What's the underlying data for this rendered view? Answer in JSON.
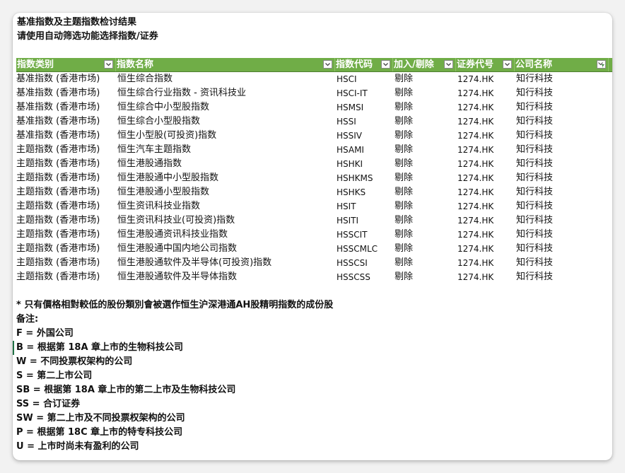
{
  "headings": {
    "title": "基准指数及主题指数检讨结果",
    "subtitle": "请使用自动筛选功能选择指数/证券"
  },
  "table": {
    "header_color": "#70ad47",
    "columns": [
      {
        "label": "指数类别",
        "filter": "dropdown"
      },
      {
        "label": "指数名称",
        "filter": "dropdown"
      },
      {
        "label": "指数代码",
        "filter": "dropdown"
      },
      {
        "label": "加入/剔除",
        "filter": "dropdown"
      },
      {
        "label": "证券代号",
        "filter": "dropdown"
      },
      {
        "label": "公司名称",
        "filter": "filter-active"
      }
    ],
    "rows": [
      [
        "基准指数 (香港市场)",
        "恒生综合指数",
        "HSCI",
        "剔除",
        "1274.HK",
        "知行科技"
      ],
      [
        "基准指数 (香港市场)",
        "恒生综合行业指数 - 资讯科技业",
        "HSCI-IT",
        "剔除",
        "1274.HK",
        "知行科技"
      ],
      [
        "基准指数 (香港市场)",
        "恒生综合中小型股指数",
        "HSMSI",
        "剔除",
        "1274.HK",
        "知行科技"
      ],
      [
        "基准指数 (香港市场)",
        "恒生综合小型股指数",
        "HSSI",
        "剔除",
        "1274.HK",
        "知行科技"
      ],
      [
        "基准指数 (香港市场)",
        "恒生小型股(可投资)指数",
        "HSSIV",
        "剔除",
        "1274.HK",
        "知行科技"
      ],
      [
        "主题指数 (香港市场)",
        "恒生汽车主题指数",
        "HSAMI",
        "剔除",
        "1274.HK",
        "知行科技"
      ],
      [
        "主题指数 (香港市场)",
        "恒生港股通指数",
        "HSHKI",
        "剔除",
        "1274.HK",
        "知行科技"
      ],
      [
        "主题指数 (香港市场)",
        "恒生港股通中小型股指数",
        "HSHKMS",
        "剔除",
        "1274.HK",
        "知行科技"
      ],
      [
        "主题指数 (香港市场)",
        "恒生港股通小型股指数",
        "HSHKS",
        "剔除",
        "1274.HK",
        "知行科技"
      ],
      [
        "主题指数 (香港市场)",
        "恒生资讯科技业指数",
        "HSIT",
        "剔除",
        "1274.HK",
        "知行科技"
      ],
      [
        "主题指数 (香港市场)",
        "恒生资讯科技业(可投资)指数",
        "HSITI",
        "剔除",
        "1274.HK",
        "知行科技"
      ],
      [
        "主题指数 (香港市场)",
        "恒生港股通资讯科技业指数",
        "HSSCIT",
        "剔除",
        "1274.HK",
        "知行科技"
      ],
      [
        "主题指数 (香港市场)",
        "恒生港股通中国内地公司指数",
        "HSSCMLC",
        "剔除",
        "1274.HK",
        "知行科技"
      ],
      [
        "主题指数 (香港市场)",
        "恒生港股通软件及半导体(可投资)指数",
        "HSSCSI",
        "剔除",
        "1274.HK",
        "知行科技"
      ],
      [
        "主题指数 (香港市场)",
        "恒生港股通软件及半导体指数",
        "HSSCSS",
        "剔除",
        "1274.HK",
        "知行科技"
      ]
    ]
  },
  "notes": {
    "footnote": "* 只有價格相對較低的股份類別會被選作恒生沪深港通AH股精明指数的成份股",
    "remarks_label": "备注:",
    "legend": [
      "F = 外国公司",
      "B = 根据第 18A 章上市的生物科技公司",
      "W = 不同投票权架构的公司",
      "S = 第二上市公司",
      "SB = 根据第 18A 章上市的第二上市及生物科技公司",
      "SS = 合订证券",
      "SW = 第二上市及不同投票权架构的公司",
      "P = 根据第 18C 章上市的特专科技公司",
      "U = 上市时尚未有盈利的公司"
    ]
  }
}
